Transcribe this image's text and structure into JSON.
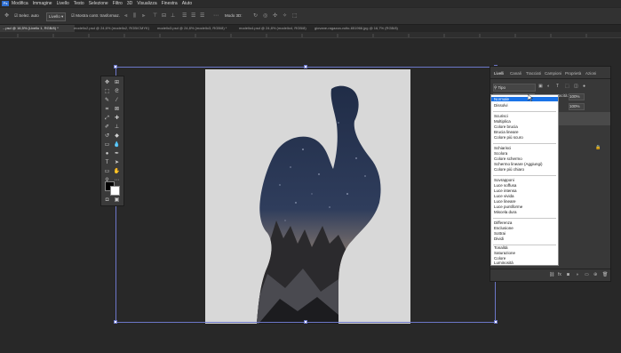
{
  "menubar": {
    "items": [
      "Modifica",
      "Immagine",
      "Livello",
      "Testo",
      "Selezione",
      "Filtro",
      "3D",
      "Visualizza",
      "Finestra",
      "Aiuto"
    ],
    "logo": "Ps"
  },
  "options_bar": {
    "auto_select_label": "Selez. auto",
    "target_value": "Livello",
    "transform_label": "Mostra contr. trasformaz.",
    "mode3d_label": "Modo 3D:"
  },
  "tabs": [
    {
      "label": "...psd @ 16,5% (Livello 1, RGB/8) *",
      "active": true
    },
    {
      "label": "modello2.psd @ 24,6% (modello2, RGB/CMYK)",
      "active": false
    },
    {
      "label": "modello3.psd @ 24,8% (modello3, RGB/8) *",
      "active": false
    },
    {
      "label": "modello4.psd @ 24,8% (modello4, RGB/8)",
      "active": false
    },
    {
      "label": "giovane-ragazza-volto-651966.jpg @ 16,7% (RGB/8)",
      "active": false
    }
  ],
  "layers_panel": {
    "tabs": [
      "Livelli",
      "Canali",
      "Tracciati",
      "Campioni",
      "Proprietà",
      "Azioni"
    ],
    "kind_filter": "Tipo",
    "blend_mode": "Normale",
    "opacity_label": "Opacità:",
    "opacity_value": "100%",
    "fill_value": "100%"
  },
  "blend_modes": [
    [
      "Normale",
      "Dissolvi"
    ],
    [
      "Scurisci",
      "Moltiplica",
      "Colore brucia",
      "Brucia lineare",
      "Colore più scuro"
    ],
    [
      "Schiarisci",
      "Scolora",
      "Colore schermo",
      "Schermo lineare (Aggiungi)",
      "Colore più chiaro"
    ],
    [
      "Sovrapponi",
      "Luce soffusa",
      "Luce intensa",
      "Luce vivida",
      "Luce lineare",
      "Luce puntiforme",
      "Miscela dura"
    ],
    [
      "Differenza",
      "Esclusione",
      "Sottrai",
      "Dividi"
    ],
    [
      "Tonalità",
      "Saturazione",
      "Colore",
      "Luminosità"
    ]
  ],
  "icons": {
    "move": "move-icon",
    "marquee": "marquee-icon",
    "lasso": "lasso-icon",
    "crop": "crop-icon",
    "brush": "brush-icon",
    "eraser": "eraser-icon",
    "pen": "pen-icon",
    "type": "type-icon",
    "hand": "hand-icon",
    "zoom": "zoom-icon"
  },
  "colors": {
    "accent": "#1a73e8",
    "selection_border": "#6c77c8",
    "foreground": "#000000",
    "background": "#ffffff"
  }
}
